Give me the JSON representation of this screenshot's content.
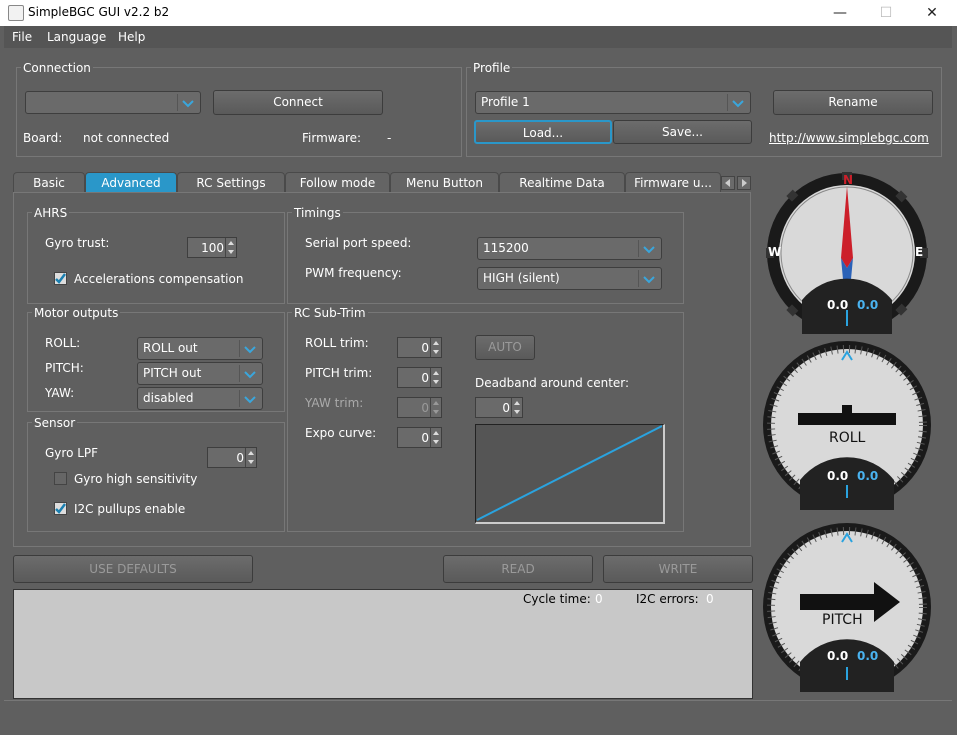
{
  "window": {
    "title": "SimpleBGC GUI v2.2 b2",
    "minimize": "—",
    "maximize": "☐",
    "close": "✕"
  },
  "menu": [
    "File",
    "Language",
    "Help"
  ],
  "connection": {
    "title": "Connection",
    "connect_label": "Connect",
    "board_label": "Board:",
    "board_value": "not connected",
    "firmware_label": "Firmware:",
    "firmware_value": "-"
  },
  "profile": {
    "title": "Profile",
    "selected": "Profile 1",
    "load_label": "Load...",
    "save_label": "Save...",
    "rename_label": "Rename",
    "link": "http://www.simplebgc.com"
  },
  "tabs": [
    "Basic",
    "Advanced",
    "RC Settings",
    "Follow mode",
    "Menu Button",
    "Realtime Data",
    "Firmware u..."
  ],
  "ahrs": {
    "title": "AHRS",
    "gyro_trust_label": "Gyro trust:",
    "gyro_trust_value": "100",
    "acc_comp_label": "Accelerations compensation"
  },
  "timings": {
    "title": "Timings",
    "serial_label": "Serial port speed:",
    "serial_value": "115200",
    "pwm_label": "PWM frequency:",
    "pwm_value": "HIGH (silent)"
  },
  "motor_outputs": {
    "title": "Motor outputs",
    "roll_label": "ROLL:",
    "roll_value": "ROLL out",
    "pitch_label": "PITCH:",
    "pitch_value": "PITCH out",
    "yaw_label": "YAW:",
    "yaw_value": "disabled"
  },
  "rc_subtrim": {
    "title": "RC Sub-Trim",
    "roll_trim_label": "ROLL trim:",
    "roll_trim_value": "0",
    "pitch_trim_label": "PITCH trim:",
    "pitch_trim_value": "0",
    "yaw_trim_label": "YAW trim:",
    "yaw_trim_value": "0",
    "expo_label": "Expo curve:",
    "expo_value": "0",
    "auto_label": "AUTO",
    "deadband_label": "Deadband around center:",
    "deadband_value": "0"
  },
  "sensor": {
    "title": "Sensor",
    "gyro_lpf_label": "Gyro LPF",
    "gyro_lpf_value": "0",
    "gyro_high_label": "Gyro high sensitivity",
    "i2c_label": "I2C pullups enable"
  },
  "actions": {
    "use_defaults": "USE DEFAULTS",
    "read": "READ",
    "write": "WRITE"
  },
  "status": {
    "cycle_label": "Cycle time:",
    "cycle_value": "0",
    "i2c_label": "I2C errors:",
    "i2c_value": "0"
  },
  "gauges": {
    "compass": {
      "n": "N",
      "w": "W",
      "e": "E",
      "left": "0.0",
      "right": "0.0"
    },
    "roll": {
      "label": "ROLL",
      "left": "0.0",
      "right": "0.0"
    },
    "pitch": {
      "label": "PITCH",
      "left": "0.0",
      "right": "0.0"
    }
  },
  "colors": {
    "accent": "#2a97c9",
    "bg": "#5f5f5f"
  }
}
